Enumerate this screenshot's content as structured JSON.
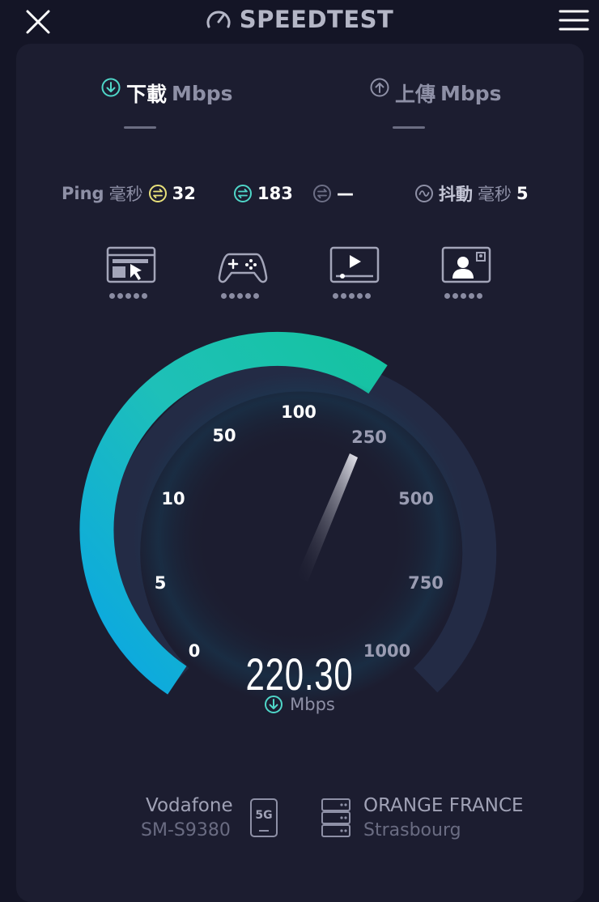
{
  "header": {
    "title": "SPEEDTEST",
    "close_icon": "close-icon",
    "menu_icon": "hamburger-menu-icon"
  },
  "tabs": {
    "download": {
      "label": "下載",
      "unit": "Mbps",
      "icon": "download-arrow-icon",
      "accent": "#4fd6c8"
    },
    "upload": {
      "label": "上傳",
      "unit": "Mbps",
      "icon": "upload-arrow-icon"
    }
  },
  "metrics": {
    "ping": {
      "label": "Ping",
      "unit": "毫秒",
      "icon": "ping-idle-icon",
      "value": "32",
      "color": "#e8e07a"
    },
    "download_latency": {
      "icon": "download-latency-icon",
      "value": "183",
      "color": "#4fd6c8"
    },
    "upload_latency": {
      "icon": "upload-latency-icon",
      "value": "—"
    },
    "jitter": {
      "label": "抖動",
      "unit": "毫秒",
      "icon": "jitter-icon",
      "value": "5"
    }
  },
  "quality": [
    {
      "name": "web-browsing-icon",
      "rating": 5
    },
    {
      "name": "gaming-icon",
      "rating": 5
    },
    {
      "name": "video-streaming-icon",
      "rating": 5
    },
    {
      "name": "video-call-icon",
      "rating": 5
    }
  ],
  "gauge": {
    "scale_labels": [
      "0",
      "5",
      "10",
      "50",
      "100",
      "250",
      "500",
      "750",
      "1000"
    ],
    "current_value": "220.30",
    "unit": "Mbps",
    "active_gradient": [
      "#0aa6e4",
      "#1ec0b8",
      "#15c3a0"
    ],
    "track_color": "#232b45"
  },
  "footer": {
    "carrier": "Vodafone",
    "device": "SM-S9380",
    "network_badge": "5G",
    "server_name": "ORANGE FRANCE",
    "server_location": "Strasbourg",
    "server_icon": "server-icon"
  }
}
